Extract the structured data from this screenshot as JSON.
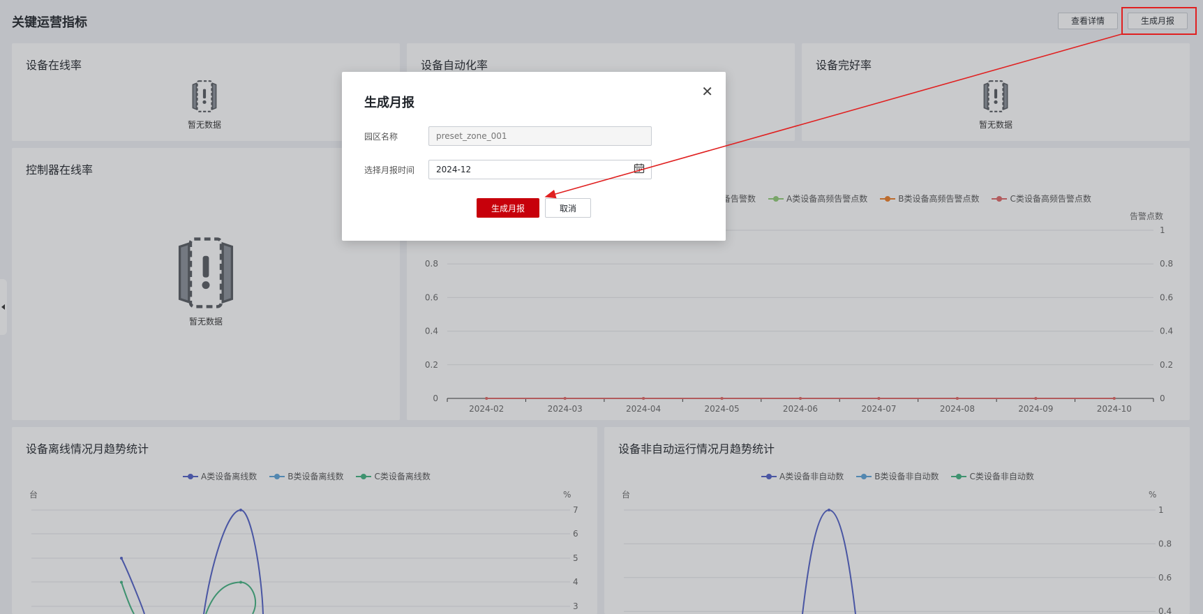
{
  "header": {
    "title": "关键运营指标",
    "view_details_label": "查看详情",
    "generate_report_label": "生成月报"
  },
  "cards": {
    "device_online_rate": {
      "title": "设备在线率",
      "empty": "暂无数据"
    },
    "device_automation_rate": {
      "title": "设备自动化率"
    },
    "device_intact_rate": {
      "title": "设备完好率",
      "empty": "暂无数据"
    },
    "controller_online_rate": {
      "title": "控制器在线率",
      "empty": "暂无数据"
    }
  },
  "alarm_chart": {
    "legend": [
      {
        "label": "备告警数",
        "color": "#9aa0a6"
      },
      {
        "label": "A类设备高频告警点数",
        "color": "#91cc75"
      },
      {
        "label": "B类设备高频告警点数",
        "color": "#ee7d24"
      },
      {
        "label": "C类设备高频告警点数",
        "color": "#e06666"
      }
    ],
    "right_axis_label": "告警点数"
  },
  "offline_card": {
    "title": "设备离线情况月趋势统计",
    "legend": [
      {
        "label": "A类设备离线数",
        "color": "#4f5fc7"
      },
      {
        "label": "B类设备离线数",
        "color": "#5ba3d9"
      },
      {
        "label": "C类设备离线数",
        "color": "#3fb27f"
      }
    ],
    "left_axis_label": "台",
    "right_axis_label": "%"
  },
  "non_auto_card": {
    "title": "设备非自动运行情况月趋势统计",
    "legend": [
      {
        "label": "A类设备非自动数",
        "color": "#4f5fc7"
      },
      {
        "label": "B类设备非自动数",
        "color": "#5ba3d9"
      },
      {
        "label": "C类设备非自动数",
        "color": "#3fb27f"
      }
    ],
    "left_axis_label": "台",
    "right_axis_label": "%"
  },
  "chart_data": [
    {
      "type": "line",
      "x": [
        "2024-02",
        "2024-03",
        "2024-04",
        "2024-05",
        "2024-06",
        "2024-07",
        "2024-08",
        "2024-09",
        "2024-10"
      ],
      "y_ticks": [
        0,
        0.2,
        0.4,
        0.6,
        0.8
      ],
      "y_right_ticks": [
        0,
        0.2,
        0.4,
        0.6,
        0.8,
        1
      ],
      "ylim": [
        0,
        1
      ],
      "series": [
        {
          "name": "B类设备高频告警点数",
          "color": "#ee7d24",
          "values": [
            0,
            0,
            0,
            0,
            0,
            0,
            0,
            0,
            0
          ]
        },
        {
          "name": "C类设备高频告警点数",
          "color": "#e06666",
          "values": [
            0,
            0,
            0,
            0,
            0,
            0,
            0,
            0,
            0
          ]
        }
      ]
    },
    {
      "type": "line",
      "y_right_ticks": [
        3,
        4,
        5,
        6,
        7
      ],
      "series": [
        {
          "name": "A类设备离线数",
          "color": "#4f5fc7",
          "values": [
            5,
            null,
            7
          ]
        },
        {
          "name": "C类设备离线数",
          "color": "#3fb27f",
          "values": [
            4,
            null,
            4
          ]
        }
      ]
    },
    {
      "type": "line",
      "y_right_ticks": [
        0.4,
        0.6,
        0.8,
        1
      ],
      "series": [
        {
          "name": "A类设备非自动数",
          "color": "#4f5fc7",
          "values": [
            1
          ]
        }
      ]
    }
  ],
  "modal": {
    "title": "生成月报",
    "zone_label": "园区名称",
    "zone_placeholder": "preset_zone_001",
    "month_label": "选择月报时间",
    "month_value": "2024-12",
    "confirm_label": "生成月报",
    "cancel_label": "取消",
    "close_icon": "close-icon"
  }
}
